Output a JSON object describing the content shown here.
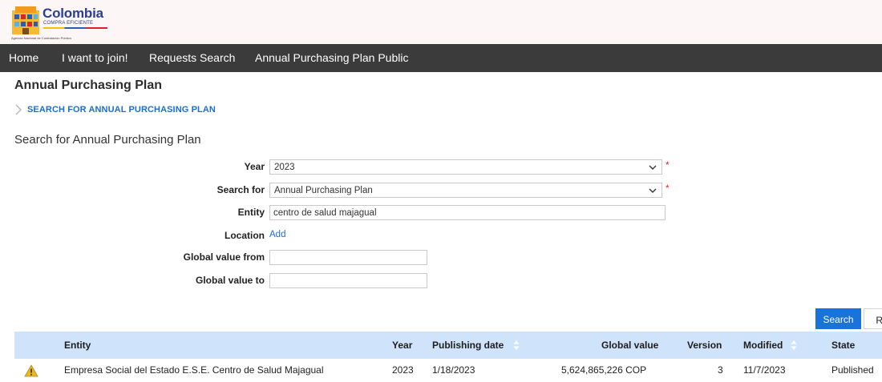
{
  "logo": {
    "title": "Colombia",
    "subtitle": "COMPRA EFICIENTE",
    "tagline": "Agencia Nacional de Contratación Pública"
  },
  "nav": {
    "items": [
      {
        "label": "Home"
      },
      {
        "label": "I want to join!"
      },
      {
        "label": "Requests Search"
      },
      {
        "label": "Annual Purchasing Plan Public"
      }
    ]
  },
  "page": {
    "title": "Annual Purchasing Plan",
    "breadcrumb": "SEARCH FOR ANNUAL PURCHASING PLAN",
    "section_title": "Search for Annual Purchasing Plan"
  },
  "form": {
    "year": {
      "label": "Year",
      "value": "2023",
      "required": "*"
    },
    "search_for": {
      "label": "Search for",
      "value": "Annual Purchasing Plan",
      "required": "*"
    },
    "entity": {
      "label": "Entity",
      "value": "centro de salud majagual"
    },
    "location": {
      "label": "Location",
      "link": "Add"
    },
    "global_from": {
      "label": "Global value from",
      "value": ""
    },
    "global_to": {
      "label": "Global value to",
      "value": ""
    }
  },
  "actions": {
    "search": "Search",
    "reset": "Re"
  },
  "table": {
    "columns": [
      "Entity",
      "Year",
      "Publishing date",
      "Global value",
      "Version",
      "Modified",
      "State"
    ],
    "rows": [
      {
        "entity": "Empresa Social del Estado E.S.E. Centro de Salud Majagual",
        "year": "2023",
        "publishing_date": "1/18/2023",
        "global_value": "5,624,865,226 COP",
        "version": "3",
        "modified": "11/7/2023",
        "state": "Published"
      }
    ]
  },
  "colors": {
    "nav_bg": "#3b3b3b",
    "link": "#1a6fcf",
    "primary_button": "#1a73d9",
    "table_header": "#cfe3fb",
    "required": "#e0282c",
    "warning": "#e8b82a"
  }
}
